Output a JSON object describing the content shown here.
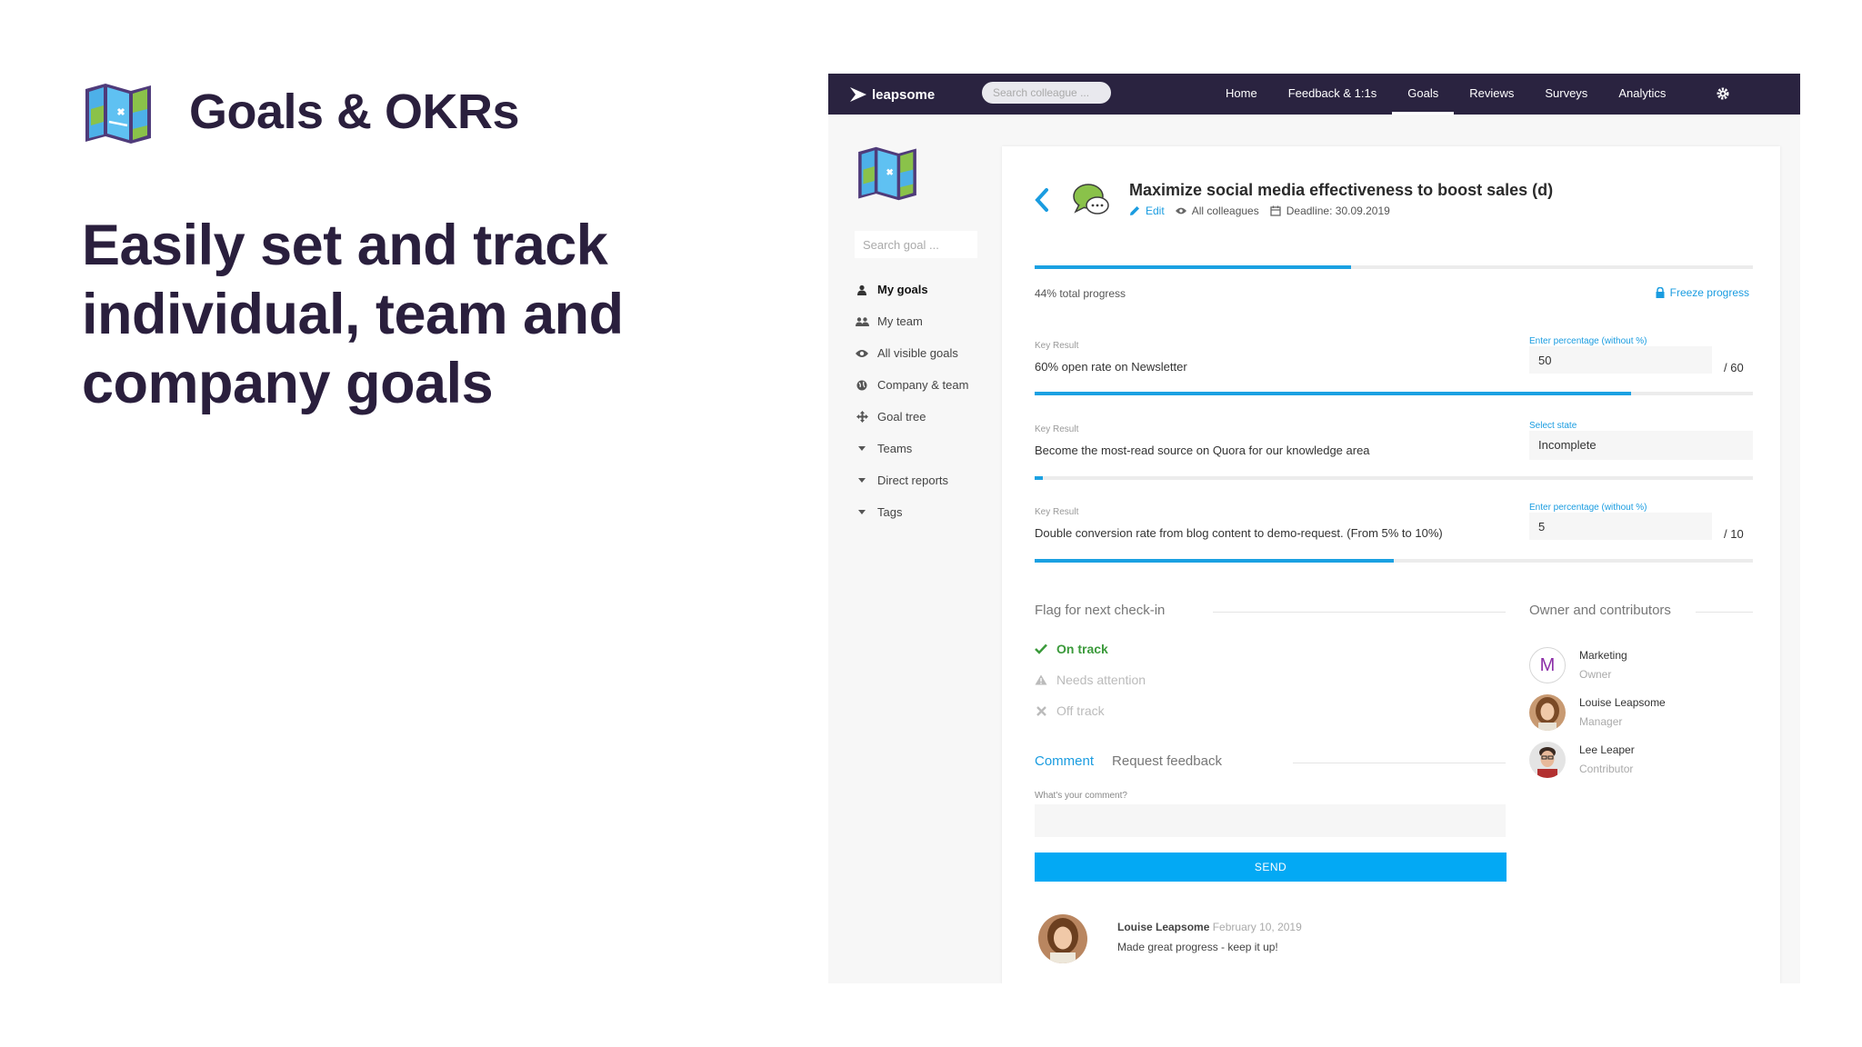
{
  "hero": {
    "title": "Goals & OKRs",
    "tagline_line1": "Easily set and track",
    "tagline_line2": "individual, team and",
    "tagline_line3": "company goals"
  },
  "topbar": {
    "brand": "leapsome",
    "search_placeholder": "Search colleague ...",
    "nav": [
      "Home",
      "Feedback & 1:1s",
      "Goals",
      "Reviews",
      "Surveys",
      "Analytics"
    ],
    "active_nav": "Goals",
    "settings_icon": "gear-icon"
  },
  "sidebar": {
    "search_placeholder": "Search goal ...",
    "items": [
      {
        "label": "My goals",
        "icon": "user-icon",
        "active": true
      },
      {
        "label": "My team",
        "icon": "users-icon"
      },
      {
        "label": "All visible goals",
        "icon": "eye-icon"
      },
      {
        "label": "Company & team",
        "icon": "globe-icon"
      },
      {
        "label": "Goal tree",
        "icon": "tree-icon"
      },
      {
        "label": "Teams",
        "icon": "caret-down-icon"
      },
      {
        "label": "Direct reports",
        "icon": "caret-down-icon"
      },
      {
        "label": "Tags",
        "icon": "caret-down-icon"
      }
    ]
  },
  "goal": {
    "title": "Maximize social media effectiveness to boost sales (d)",
    "edit": "Edit",
    "visibility": "All colleagues",
    "deadline": "Deadline: 30.09.2019",
    "progress": 0.44,
    "progress_text": "44% total progress",
    "freeze": "Freeze progress"
  },
  "key_results": [
    {
      "label": "Key Result",
      "text": "60% open rate on Newsletter",
      "input_label": "Enter percentage (without %)",
      "value": "50",
      "target": "/ 60",
      "progress": 0.83
    },
    {
      "label": "Key Result",
      "text": "Become the most-read source on Quora for our knowledge area",
      "input_label": "Select state",
      "value": "Incomplete",
      "progress": 0.012
    },
    {
      "label": "Key Result",
      "text": "Double conversion rate from blog content to demo-request. (From 5% to 10%)",
      "input_label": "Enter percentage (without %)",
      "value": "5",
      "target": "/ 10",
      "progress": 0.5
    }
  ],
  "checkin": {
    "heading": "Flag for next check-in",
    "options": [
      "On track",
      "Needs attention",
      "Off track"
    ],
    "selected": "On track"
  },
  "owners": {
    "heading": "Owner and contributors",
    "people": [
      {
        "name": "Marketing",
        "role": "Owner",
        "initial": "M"
      },
      {
        "name": "Louise Leapsome",
        "role": "Manager"
      },
      {
        "name": "Lee Leaper",
        "role": "Contributor"
      }
    ]
  },
  "comment": {
    "tabs": [
      "Comment",
      "Request feedback"
    ],
    "active_tab": "Comment",
    "input_label": "What's your comment?",
    "send": "SEND",
    "entry": {
      "author": "Louise Leapsome",
      "date": "February 10, 2019",
      "text": "Made great progress - keep it up!"
    }
  },
  "colors": {
    "accent": "#1ba1e2",
    "topbar": "#2a2340",
    "success": "#3b9a3b",
    "heading": "#2a1f3d"
  }
}
